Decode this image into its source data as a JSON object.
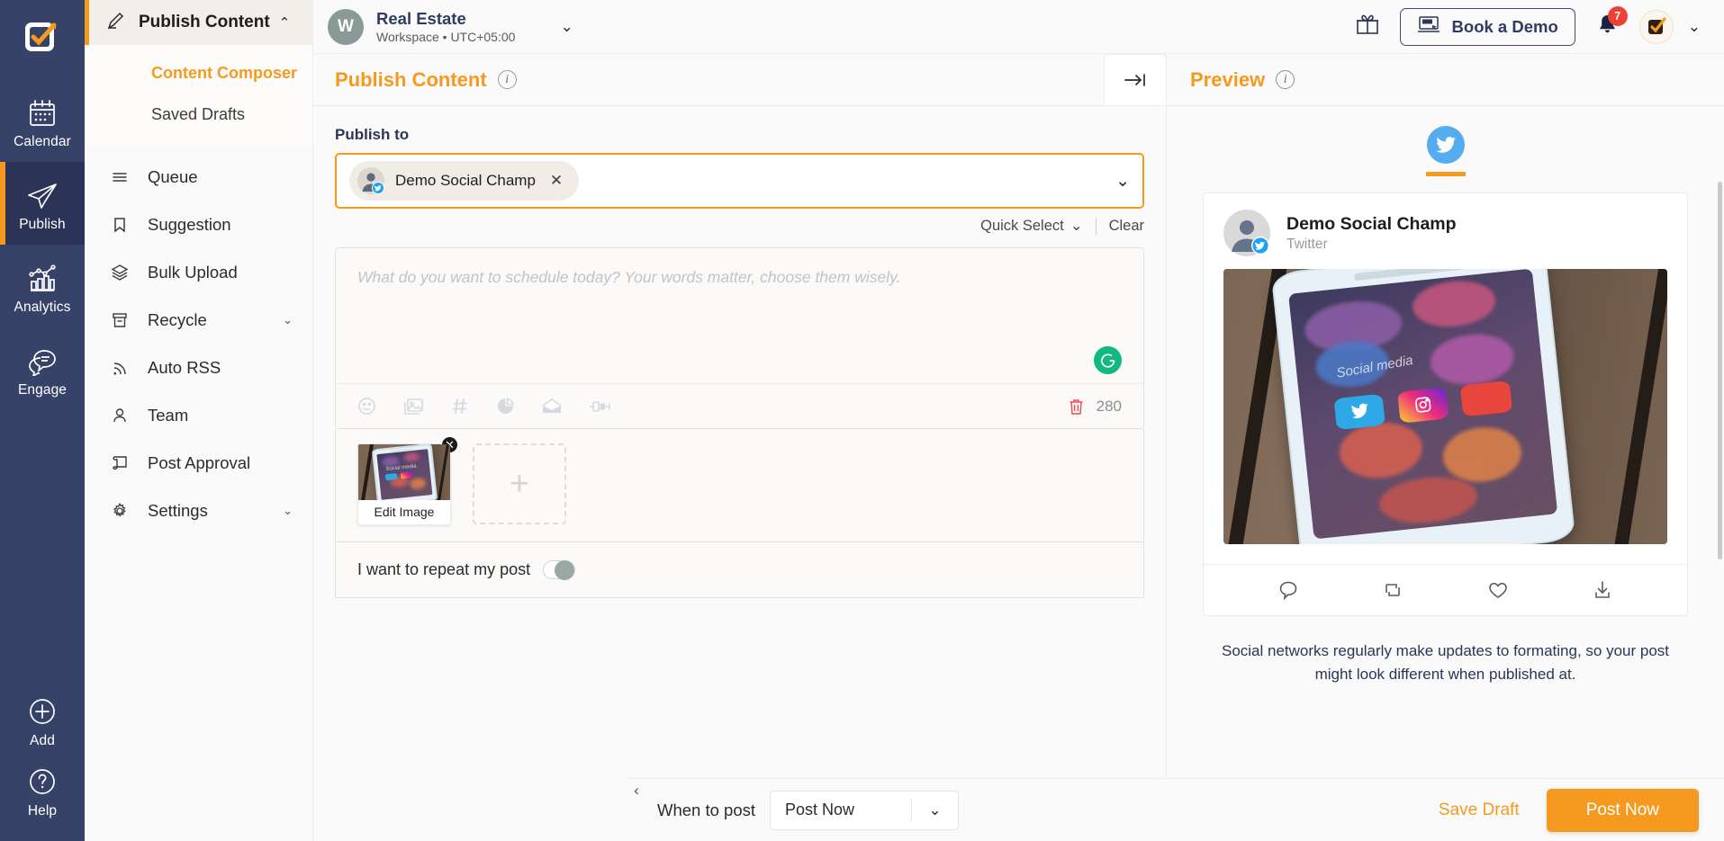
{
  "rail": {
    "logo_alt": "social-champ-logo",
    "items": [
      {
        "label": "Calendar",
        "icon": "calendar-icon",
        "active": false
      },
      {
        "label": "Publish",
        "icon": "paper-plane-icon",
        "active": true
      },
      {
        "label": "Analytics",
        "icon": "bar-chart-icon",
        "active": false
      },
      {
        "label": "Engage",
        "icon": "chat-bubbles-icon",
        "active": false
      }
    ],
    "bottom": [
      {
        "label": "Add",
        "icon": "plus-circle-icon"
      },
      {
        "label": "Help",
        "icon": "question-circle-icon"
      }
    ]
  },
  "sidebar": {
    "section_title": "Publish Content",
    "section_chevron": "⌃",
    "sub_items": [
      {
        "label": "Content Composer",
        "active": true
      },
      {
        "label": "Saved Drafts",
        "active": false
      }
    ],
    "items": [
      {
        "label": "Queue",
        "icon": "list-icon",
        "caret": ""
      },
      {
        "label": "Suggestion",
        "icon": "bookmark-icon",
        "caret": ""
      },
      {
        "label": "Bulk Upload",
        "icon": "layers-icon",
        "caret": ""
      },
      {
        "label": "Recycle",
        "icon": "archive-icon",
        "caret": "⌄"
      },
      {
        "label": "Auto RSS",
        "icon": "rss-icon",
        "caret": ""
      },
      {
        "label": "Team",
        "icon": "user-icon",
        "caret": ""
      },
      {
        "label": "Post Approval",
        "icon": "scroll-icon",
        "caret": ""
      },
      {
        "label": "Settings",
        "icon": "gear-icon",
        "caret": "⌄"
      }
    ]
  },
  "topbar": {
    "workspace_initial": "W",
    "workspace_name": "Real Estate",
    "workspace_meta": "Workspace • UTC+05:00",
    "workspace_chevron": "⌄",
    "gift_icon": "gift-icon",
    "demo_button": "Book a Demo",
    "demo_icon": "demo-laptop-icon",
    "notification_count": "7",
    "user_chevron": "⌄"
  },
  "compose": {
    "title": "Publish Content",
    "info_icon": "info-icon",
    "collapse_icon": "→|",
    "publish_to_label": "Publish to",
    "selected_account": "Demo Social Champ",
    "chip_remove": "✕",
    "select_caret": "⌄",
    "quick_select": "Quick Select",
    "quick_select_caret": "⌄",
    "clear": "Clear",
    "placeholder": "What do you want to schedule today? Your words matter, choose them wisely.",
    "grammarly_icon": "grammarly-icon",
    "tools": [
      "emoji-icon",
      "image-icon",
      "hashtag-icon",
      "pie-chart-icon",
      "envelope-icon",
      "plug-icon"
    ],
    "trash_icon": "trash-icon",
    "char_count": "280",
    "thumb_caption": "Edit Image",
    "thumb_remove": "✕",
    "add_media": "+",
    "repeat_label": "I want to repeat my post",
    "repeat_on": false
  },
  "preview": {
    "title": "Preview",
    "info_icon": "info-icon",
    "network": "twitter",
    "account_name": "Demo Social Champ",
    "account_platform": "Twitter",
    "actions": [
      "reply-icon",
      "retweet-icon",
      "like-icon",
      "share-icon"
    ],
    "note": "Social networks regularly make updates to formating, so your post might look different when published at."
  },
  "footer": {
    "when_label": "When to post",
    "when_value": "Post Now",
    "when_caret": "⌄",
    "save_draft": "Save Draft",
    "post_now": "Post Now",
    "collapse_left": "‹"
  },
  "colors": {
    "accent": "#f59a1e",
    "rail_bg": "#374269",
    "rail_active": "#2b3457",
    "twitter": "#55acee",
    "badge_red": "#ef4133",
    "grammarly_green": "#11b87f"
  }
}
